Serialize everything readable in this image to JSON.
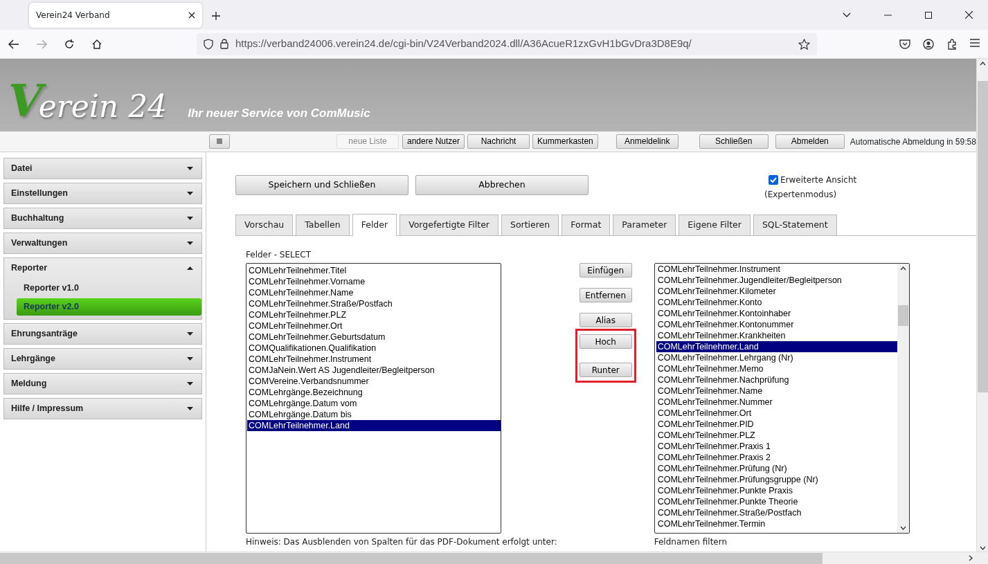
{
  "browser": {
    "tab_title": "Verein24 Verband",
    "url": "https://verband24006.verein24.de/cgi-bin/V24Verband2024.dll/A36AcueR1zxGvH1bGvDra3D8E9q/"
  },
  "header": {
    "logo_mark": "V",
    "logo_text": "erein 24",
    "slogan": "Ihr neuer Service von ComMusic"
  },
  "toolbar": {
    "buttons": [
      {
        "label": "neue Liste",
        "disabled": true
      },
      {
        "label": "andere Nutzer",
        "disabled": false
      },
      {
        "label": "Nachricht",
        "disabled": false
      },
      {
        "label": "Kummerkasten",
        "disabled": false
      },
      {
        "label": "Anmeldelink",
        "disabled": false
      },
      {
        "label": "Schließen",
        "disabled": false
      },
      {
        "label": "Abmelden",
        "disabled": false
      }
    ],
    "session": "Automatische Abmeldung in 59:58"
  },
  "sidebar": {
    "items": [
      {
        "label": "Datei",
        "expanded": false
      },
      {
        "label": "Einstellungen",
        "expanded": false
      },
      {
        "label": "Buchhaltung",
        "expanded": false
      },
      {
        "label": "Verwaltungen",
        "expanded": false
      },
      {
        "label": "Reporter",
        "expanded": true,
        "children": [
          {
            "label": "Reporter v1.0",
            "selected": false
          },
          {
            "label": "Reporter v2.0",
            "selected": true
          }
        ]
      },
      {
        "label": "Ehrungsanträge",
        "expanded": false
      },
      {
        "label": "Lehrgänge",
        "expanded": false
      },
      {
        "label": "Meldung",
        "expanded": false
      },
      {
        "label": "Hilfe / Impressum",
        "expanded": false
      }
    ]
  },
  "actions": [
    "Speichern und Schließen",
    "Abbrechen"
  ],
  "expert": {
    "label": "Erweiterte Ansicht",
    "checked": true,
    "note": "(Expertenmodus)"
  },
  "tabs": [
    {
      "label": "Vorschau",
      "selected": false
    },
    {
      "label": "Tabellen",
      "selected": false
    },
    {
      "label": "Felder",
      "selected": true
    },
    {
      "label": "Vorgefertigte Filter",
      "selected": false
    },
    {
      "label": "Sortieren",
      "selected": false
    },
    {
      "label": "Format",
      "selected": false
    },
    {
      "label": "Parameter",
      "selected": false
    },
    {
      "label": "Eigene Filter",
      "selected": false
    },
    {
      "label": "SQL-Statement",
      "selected": false
    }
  ],
  "selected_fields": {
    "title": "Felder - SELECT",
    "items": [
      {
        "label": "COMLehrTeilnehmer.Titel",
        "selected": false
      },
      {
        "label": "COMLehrTeilnehmer.Vorname",
        "selected": false
      },
      {
        "label": "COMLehrTeilnehmer.Name",
        "selected": false
      },
      {
        "label": "COMLehrTeilnehmer.Straße/Postfach",
        "selected": false
      },
      {
        "label": "COMLehrTeilnehmer.PLZ",
        "selected": false
      },
      {
        "label": "COMLehrTeilnehmer.Ort",
        "selected": false
      },
      {
        "label": "COMLehrTeilnehmer.Geburtsdatum",
        "selected": false
      },
      {
        "label": "COMQualifikationen.Qualifikation",
        "selected": false
      },
      {
        "label": "COMLehrTeilnehmer.Instrument",
        "selected": false
      },
      {
        "label": "COMJaNein.Wert AS Jugendleiter/Begleitperson",
        "selected": false
      },
      {
        "label": "COMVereine.Verbandsnummer",
        "selected": false
      },
      {
        "label": "COMLehrgänge.Bezeichnung",
        "selected": false
      },
      {
        "label": "COMLehrgänge.Datum vom",
        "selected": false
      },
      {
        "label": "COMLehrgänge.Datum bis",
        "selected": false
      },
      {
        "label": "COMLehrTeilnehmer.Land",
        "selected": true
      }
    ],
    "hint": "Hinweis: Das Ausblenden von Spalten für das PDF-Dokument erfolgt unter:"
  },
  "move_buttons": [
    {
      "label": "Einfügen",
      "highlighted": false
    },
    {
      "label": "Entfernen",
      "highlighted": false
    },
    {
      "label": "Alias",
      "highlighted": false
    },
    {
      "label": "Hoch",
      "highlighted": true
    },
    {
      "label": "Runter",
      "highlighted": true
    }
  ],
  "available_fields": {
    "items": [
      {
        "label": "COMLehrTeilnehmer.Instrument",
        "selected": false
      },
      {
        "label": "COMLehrTeilnehmer.Jugendleiter/Begleitperson",
        "selected": false
      },
      {
        "label": "COMLehrTeilnehmer.Kilometer",
        "selected": false
      },
      {
        "label": "COMLehrTeilnehmer.Konto",
        "selected": false
      },
      {
        "label": "COMLehrTeilnehmer.Kontoinhaber",
        "selected": false
      },
      {
        "label": "COMLehrTeilnehmer.Kontonummer",
        "selected": false
      },
      {
        "label": "COMLehrTeilnehmer.Krankheiten",
        "selected": false
      },
      {
        "label": "COMLehrTeilnehmer.Land",
        "selected": true
      },
      {
        "label": "COMLehrTeilnehmer.Lehrgang (Nr)",
        "selected": false
      },
      {
        "label": "COMLehrTeilnehmer.Memo",
        "selected": false
      },
      {
        "label": "COMLehrTeilnehmer.Nachprüfung",
        "selected": false
      },
      {
        "label": "COMLehrTeilnehmer.Name",
        "selected": false
      },
      {
        "label": "COMLehrTeilnehmer.Nummer",
        "selected": false
      },
      {
        "label": "COMLehrTeilnehmer.Ort",
        "selected": false
      },
      {
        "label": "COMLehrTeilnehmer.PID",
        "selected": false
      },
      {
        "label": "COMLehrTeilnehmer.PLZ",
        "selected": false
      },
      {
        "label": "COMLehrTeilnehmer.Praxis 1",
        "selected": false
      },
      {
        "label": "COMLehrTeilnehmer.Praxis 2",
        "selected": false
      },
      {
        "label": "COMLehrTeilnehmer.Prüfung (Nr)",
        "selected": false
      },
      {
        "label": "COMLehrTeilnehmer.Prüfungsgruppe (Nr)",
        "selected": false
      },
      {
        "label": "COMLehrTeilnehmer.Punkte Praxis",
        "selected": false
      },
      {
        "label": "COMLehrTeilnehmer.Punkte Theorie",
        "selected": false
      },
      {
        "label": "COMLehrTeilnehmer.Straße/Postfach",
        "selected": false
      },
      {
        "label": "COMLehrTeilnehmer.Termin",
        "selected": false
      }
    ],
    "filter_label": "Feldnamen filtern"
  }
}
